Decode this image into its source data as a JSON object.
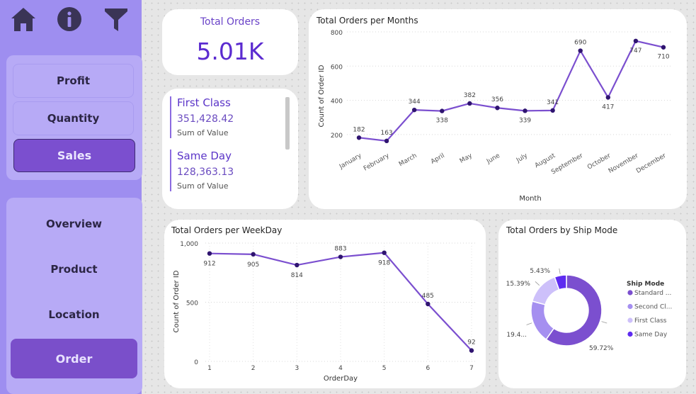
{
  "nav": {
    "icons": [
      "home-icon",
      "info-icon",
      "filter-icon"
    ],
    "metric_buttons": [
      "Profit",
      "Quantity",
      "Sales"
    ],
    "page_buttons": [
      "Overview",
      "Product",
      "Location",
      "Order"
    ]
  },
  "kpi": {
    "title": "Total Orders",
    "value": "5.01K"
  },
  "multirow": [
    {
      "category": "First Class",
      "value": "351,428.42",
      "label": "Sum of Value"
    },
    {
      "category": "Same Day",
      "value": "128,363.13",
      "label": "Sum of Value"
    }
  ],
  "colors": {
    "accent": "#6a43c8",
    "line": "#7b4fcf",
    "point": "#2f1470",
    "sidebar": "#9e8ef0",
    "active_button": "#7b4fcf"
  },
  "chart_data": [
    {
      "type": "line",
      "title": "Total Orders per Months",
      "xlabel": "Month",
      "ylabel": "Count of Order ID",
      "categories": [
        "January",
        "February",
        "March",
        "April",
        "May",
        "June",
        "July",
        "August",
        "September",
        "October",
        "November",
        "December"
      ],
      "values": [
        182,
        163,
        344,
        338,
        382,
        356,
        339,
        341,
        690,
        417,
        747,
        710
      ],
      "data_labels": [
        "182",
        "163",
        "344",
        "338",
        "382",
        "356",
        "339",
        "341",
        "690",
        "417",
        "747",
        "710"
      ],
      "yticks": [
        "200",
        "400",
        "600",
        "800"
      ],
      "ylim": [
        150,
        800
      ],
      "grid": true
    },
    {
      "type": "line",
      "title": "Total Orders per WeekDay",
      "xlabel": "OrderDay",
      "ylabel": "Count of Order ID",
      "categories": [
        "1",
        "2",
        "3",
        "4",
        "5",
        "6",
        "7"
      ],
      "values": [
        912,
        905,
        814,
        883,
        918,
        485,
        92
      ],
      "data_labels": [
        "912",
        "905",
        "814",
        "883",
        "918",
        "485",
        "92"
      ],
      "yticks": [
        "0",
        "500",
        "1,000"
      ],
      "ylim": [
        0,
        1000
      ],
      "grid": true
    },
    {
      "type": "pie",
      "donut": true,
      "title": "Total Orders by Ship Mode",
      "legend_title": "Ship Mode",
      "legend_position": "right",
      "categories": [
        "Standard ...",
        "Second Cl...",
        "First Class",
        "Same Day"
      ],
      "values": [
        59.72,
        19.46,
        15.39,
        5.43
      ],
      "slice_labels": [
        "59.72%",
        "19.4...",
        "15.39%",
        "5.43%"
      ],
      "colors": [
        "#7b4fcf",
        "#a58ff0",
        "#cdc0fa",
        "#5e2bf0"
      ]
    }
  ]
}
